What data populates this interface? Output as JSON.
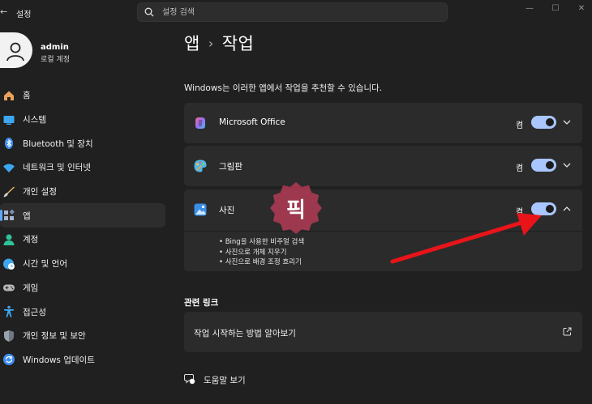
{
  "window": {
    "title": "설정",
    "back_glyph": "←",
    "minimize_glyph": "—",
    "maximize_glyph": "☐",
    "close_glyph": "✕"
  },
  "search": {
    "placeholder": "설정 검색"
  },
  "profile": {
    "name": "admin",
    "account_type": "로컬 계정"
  },
  "nav": {
    "items": [
      {
        "label": "홈",
        "icon": "home-icon"
      },
      {
        "label": "시스템",
        "icon": "monitor-icon"
      },
      {
        "label": "Bluetooth 및 장치",
        "icon": "bluetooth-icon"
      },
      {
        "label": "네트워크 및 인터넷",
        "icon": "wifi-icon"
      },
      {
        "label": "개인 설정",
        "icon": "brush-icon"
      },
      {
        "label": "앱",
        "icon": "apps-icon",
        "selected": true
      },
      {
        "label": "계정",
        "icon": "person-icon"
      },
      {
        "label": "시간 및 언어",
        "icon": "clock-globe-icon"
      },
      {
        "label": "게임",
        "icon": "gamepad-icon"
      },
      {
        "label": "접근성",
        "icon": "accessibility-icon"
      },
      {
        "label": "개인 정보 및 보안",
        "icon": "shield-icon"
      },
      {
        "label": "Windows 업데이트",
        "icon": "update-icon"
      }
    ]
  },
  "breadcrumb": {
    "parent": "앱",
    "separator": "›",
    "current": "작업"
  },
  "intro": "Windows는 이러한 앱에서 작업을 추천할 수 있습니다.",
  "apps": [
    {
      "name": "Microsoft Office",
      "icon": "office-icon",
      "state_label": "켬",
      "on": true,
      "expanded": false
    },
    {
      "name": "그림판",
      "icon": "paint-icon",
      "state_label": "켬",
      "on": true,
      "expanded": false
    },
    {
      "name": "사진",
      "icon": "photos-icon",
      "state_label": "켬",
      "on": true,
      "expanded": true,
      "actions": [
        "• Bing을 사용한 비주얼 검색",
        "• 사진으로 개체 지우기",
        "• 사진으로 배경 조정 흐리기"
      ]
    }
  ],
  "related": {
    "title": "관련 링크",
    "link_label": "작업 시작하는 방법 알아보기"
  },
  "help": {
    "label": "도움말 보기"
  },
  "watermark": {
    "text": "픽"
  },
  "colors": {
    "background": "#202020",
    "card": "#2b2b2b",
    "accent": "#a9c6ff",
    "arrow": "#e8141a",
    "watermark": "#be3c5a"
  }
}
